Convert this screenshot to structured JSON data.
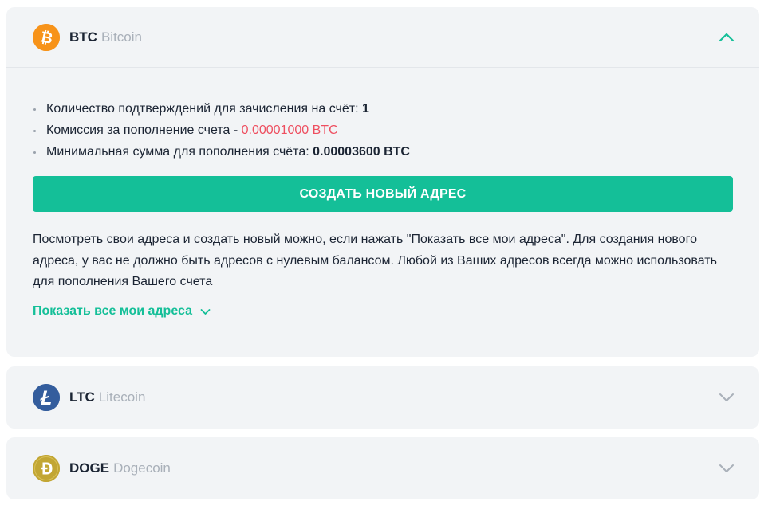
{
  "coins": {
    "btc": {
      "ticker": "BTC",
      "name": "Bitcoin",
      "icon": "bitcoin-icon",
      "color": "#f7931a",
      "expanded": true,
      "info": {
        "confirmations_label": "Количество подтверждений для зачисления на счёт: ",
        "confirmations_value": "1",
        "fee_label": "Комиссия за пополнение счета - ",
        "fee_value": "0.00001000 BTC",
        "min_label": "Минимальная сумма для пополнения счёта: ",
        "min_value": "0.00003600 BTC"
      },
      "create_button": "СОЗДАТЬ НОВЫЙ АДРЕС",
      "description": "Посмотреть свои адреса и создать новый можно, если нажать \"Показать все мои адреса\". Для создания нового адреса, у вас не должно быть адресов с нулевым балансом. Любой из Ваших адресов всегда можно использовать для пополнения Вашего счета",
      "show_all_link": "Показать все мои адреса"
    },
    "ltc": {
      "ticker": "LTC",
      "name": "Litecoin",
      "icon": "litecoin-icon",
      "color": "#345d9d",
      "expanded": false
    },
    "doge": {
      "ticker": "DOGE",
      "name": "Dogecoin",
      "icon": "dogecoin-icon",
      "color": "#c2a633",
      "expanded": false
    }
  },
  "colors": {
    "accent": "#14bf98",
    "fee_red": "#ee4f60",
    "card_bg": "#f2f4f6",
    "muted_text": "#a9b0b9"
  }
}
